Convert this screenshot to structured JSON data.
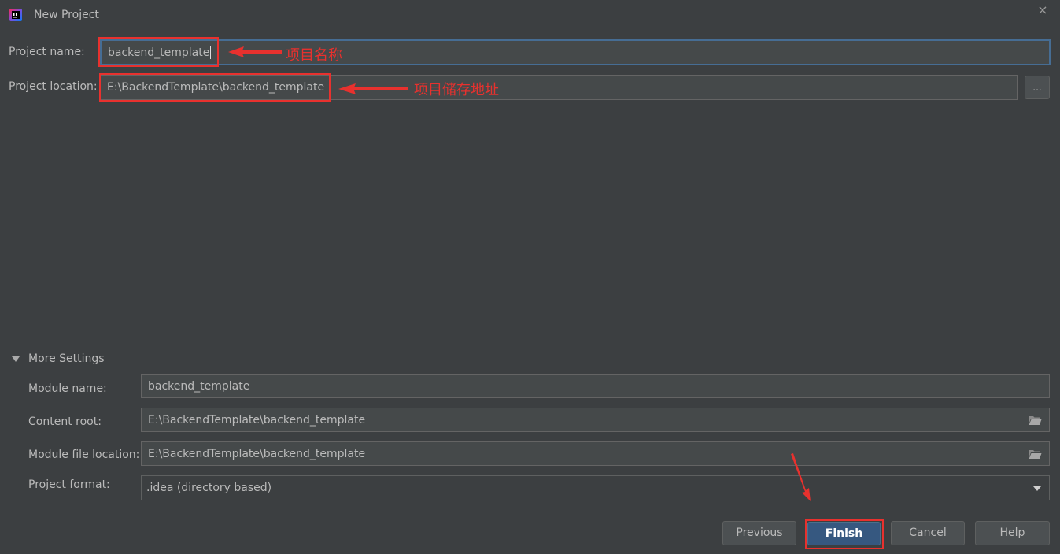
{
  "window": {
    "title": "New Project",
    "close_symbol": "×"
  },
  "form": {
    "project_name": {
      "label": "Project name:",
      "value": "backend_template"
    },
    "project_location": {
      "label": "Project location:",
      "value": "E:\\BackendTemplate\\backend_template",
      "browse_label": "..."
    }
  },
  "annotations": {
    "name_note": "项目名称",
    "location_note": "项目储存地址",
    "color": "#e8312e"
  },
  "more_settings": {
    "header": "More Settings",
    "module_name": {
      "label": "Module name:",
      "value": "backend_template"
    },
    "content_root": {
      "label": "Content root:",
      "value": "E:\\BackendTemplate\\backend_template"
    },
    "module_file_location": {
      "label": "Module file location:",
      "value": "E:\\BackendTemplate\\backend_template"
    },
    "project_format": {
      "label": "Project format:",
      "value": ".idea (directory based)"
    }
  },
  "buttons": {
    "previous": "Previous",
    "finish": "Finish",
    "cancel": "Cancel",
    "help": "Help"
  },
  "icons": {
    "app": "intellij-idea-icon",
    "close": "close-icon",
    "folder": "folder-icon",
    "dropdown": "chevron-down-icon",
    "collapse": "triangle-down-icon"
  },
  "colors": {
    "background": "#3c3f41",
    "field": "#45494a",
    "focus_border": "#466d94",
    "primary_button": "#365880"
  }
}
